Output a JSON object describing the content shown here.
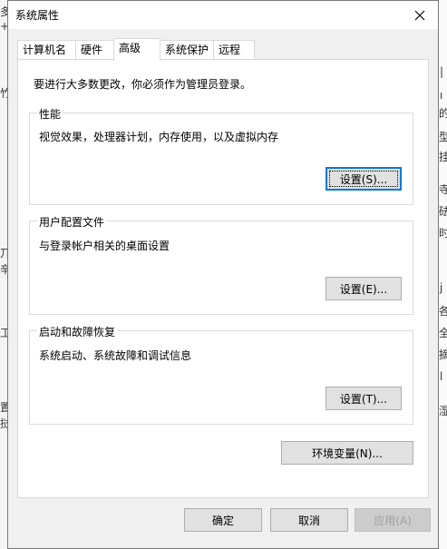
{
  "background": {
    "left_chars": [
      "多",
      "+",
      "竹",
      "丌",
      "辛",
      "工",
      "置",
      "挝"
    ],
    "right_chars": [
      "|",
      "ı",
      "的",
      "型",
      "挂",
      "寺",
      "砝",
      "时",
      "j",
      "各",
      "全",
      "摘",
      "l",
      "湿"
    ]
  },
  "window": {
    "title": "系统属性",
    "close_glyph": "✕"
  },
  "tabs": [
    {
      "label": "计算机名"
    },
    {
      "label": "硬件"
    },
    {
      "label": "高级"
    },
    {
      "label": "系统保护"
    },
    {
      "label": "远程"
    }
  ],
  "active_tab": "高级",
  "notice": "要进行大多数更改，你必须作为管理员登录。",
  "performance": {
    "legend": "性能",
    "description": "视觉效果，处理器计划，内存使用，以及虚拟内存",
    "button": "设置(S)..."
  },
  "user_profiles": {
    "legend": "用户配置文件",
    "description": "与登录帐户相关的桌面设置",
    "button": "设置(E)..."
  },
  "startup_recovery": {
    "legend": "启动和故障恢复",
    "description": "系统启动、系统故障和调试信息",
    "button": "设置(T)..."
  },
  "env_vars_button": "环境变量(N)...",
  "footer": {
    "ok": "确定",
    "cancel": "取消",
    "apply": "应用(A)"
  },
  "colors": {
    "focus_border": "#0078d7",
    "dialog_bg": "#f0f0f0",
    "button_bg": "#e1e1e1"
  }
}
